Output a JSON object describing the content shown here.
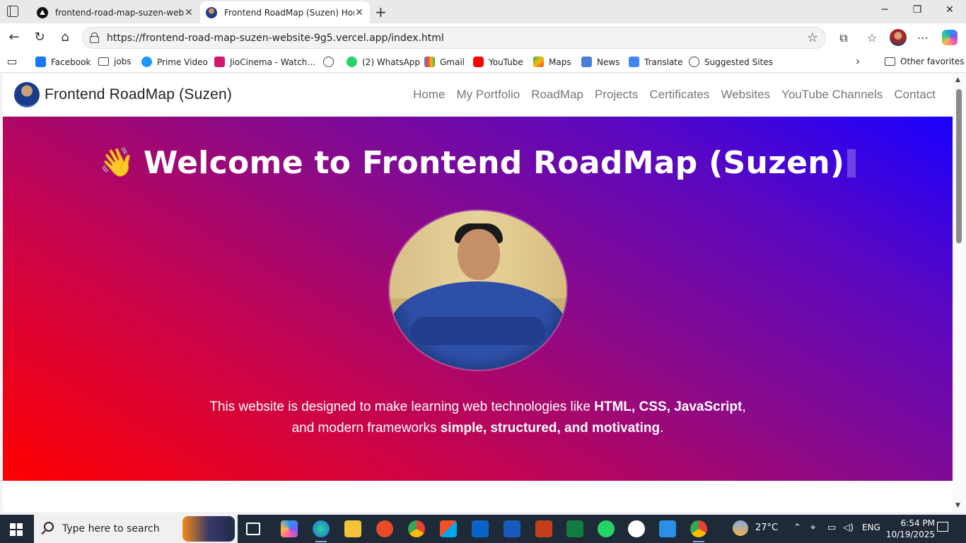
{
  "browser": {
    "tabs": [
      {
        "title": "frontend-road-map-suzen-websit",
        "active": false
      },
      {
        "title": "Frontend RoadMap (Suzen) Home",
        "active": true
      }
    ],
    "url": "https://frontend-road-map-suzen-website-9g5.vercel.app/index.html",
    "favorites": [
      {
        "label": "Facebook",
        "icon": "facebook-icon"
      },
      {
        "label": "jobs",
        "icon": "folder-icon"
      },
      {
        "label": "Prime Video",
        "icon": "prime-video-icon"
      },
      {
        "label": "JioCinema - Watch...",
        "icon": "jiocinema-icon"
      },
      {
        "label": "",
        "icon": "globe-icon"
      },
      {
        "label": "(2) WhatsApp",
        "icon": "whatsapp-icon"
      },
      {
        "label": "Gmail",
        "icon": "gmail-icon"
      },
      {
        "label": "YouTube",
        "icon": "youtube-icon"
      },
      {
        "label": "Maps",
        "icon": "maps-icon"
      },
      {
        "label": "News",
        "icon": "news-icon"
      },
      {
        "label": "Translate",
        "icon": "translate-icon"
      },
      {
        "label": "Suggested Sites",
        "icon": "globe-icon"
      }
    ],
    "other_favorites": "Other favorites"
  },
  "site": {
    "brand": "Frontend RoadMap (Suzen)",
    "nav": [
      "Home",
      "My Portfolio",
      "RoadMap",
      "Projects",
      "Certificates",
      "Websites",
      "YouTube Channels",
      "Contact"
    ],
    "hero": {
      "emoji": "👋",
      "title": "Welcome to Frontend RoadMap (Suzen)",
      "desc_line1_prefix": "This website is designed to make learning web technologies like ",
      "desc_line1_bold": "HTML, CSS, JavaScript",
      "desc_line1_suffix": ",",
      "desc_line2_prefix": "and modern frameworks ",
      "desc_line2_bold": "simple, structured, and motivating",
      "desc_line2_suffix": "."
    }
  },
  "taskbar": {
    "search_placeholder": "Type here to search",
    "weather": "27°C",
    "language": "ENG",
    "time": "6:54 PM",
    "date": "10/19/2025"
  },
  "colors": {
    "hero_gradient_start": "#ff0000",
    "hero_gradient_end": "#1a00ff",
    "nav_link": "#777777"
  }
}
